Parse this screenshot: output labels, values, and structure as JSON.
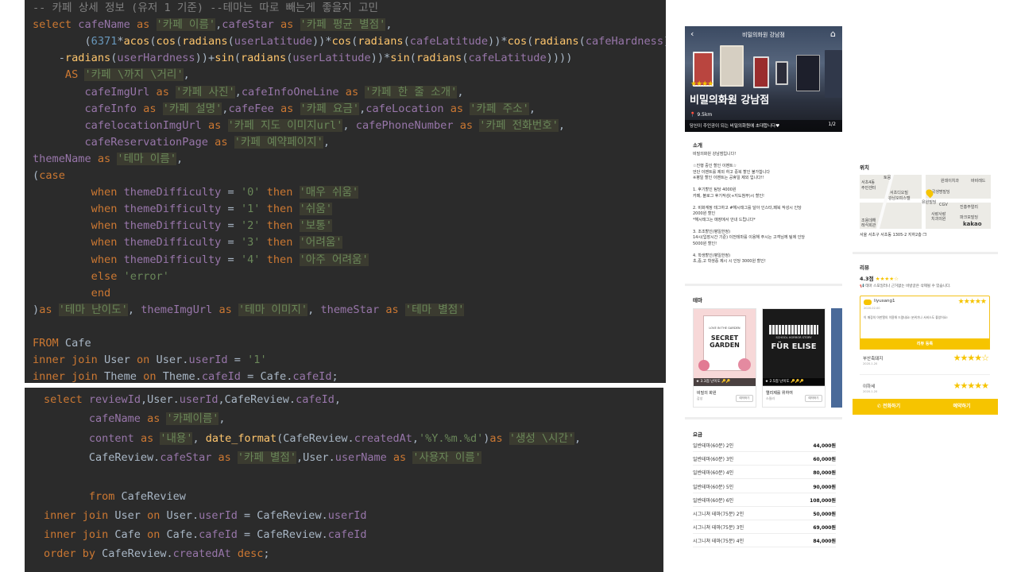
{
  "top_code": {
    "lines": [
      "-- 카페 상세 정보 (유저 1 기준) --테마는 따로 빼는게 좋을지 고민",
      "select cafeName as '카페 이름',cafeStar as '카페 평균 별점',",
      "        (6371*acos(cos(radians(userLatitude))*cos(radians(cafeLatitude))*cos(radians(cafeHardness)",
      "    -radians(userHardness))+sin(radians(userLatitude))*sin(radians(cafeLatitude))))",
      "     AS '카페 \\까지 \\거리',",
      "        cafeImgUrl as '카페 사진',cafeInfoOneLine as '카페 한 줄 소개',",
      "        cafeInfo as '카페 설명',cafeFee as '카페 요금',cafeLocation as '카페 주소',",
      "        cafelocationImgUrl as '카페 지도 이미지url', cafePhoneNumber as '카페 전화번호',",
      "        cafeReservationPage as '카페 예약페이지',",
      "themeName as '테마 이름',",
      "(case",
      "         when themeDifficulty = '0' then '매우 쉬움'",
      "         when themeDifficulty = '1' then '쉬움'",
      "         when themeDifficulty = '2' then '보통'",
      "         when themeDifficulty = '3' then '어려움'",
      "         when themeDifficulty = '4' then '아주 어려움'",
      "         else 'error'",
      "         end",
      ")as '테마 난이도', themeImgUrl as '테마 이미지', themeStar as '테마 별점'",
      "",
      "FROM Cafe",
      "inner join User on User.userId = '1'",
      "inner join Theme on Theme.cafeId = Cafe.cafeId;"
    ]
  },
  "bottom_code": {
    "lines": [
      "select reviewId,User.userId,CafeReview.cafeId,",
      "       cafeName as '카페이름',",
      "       content as '내용', date_format(CafeReview.createdAt,'%Y.%m.%d')as '생성 \\시간',",
      "       CafeReview.cafeStar as '카페 별점',User.userName as '사용자 이름'",
      "",
      "       from CafeReview",
      "inner join User on User.userId = CafeReview.userId",
      "inner join Cafe on Cafe.cafeId = CafeReview.cafeId",
      "order by CafeReview.createdAt desc;"
    ]
  },
  "phone_left": {
    "top_title": "비밀의화원 강남점",
    "hero_stars": "★★★★",
    "hero_name": "비밀의화원 강남점",
    "distance": "9.5km",
    "hero_desc": "당신이 주인공이 되는 비밀의화원에 초대합니다♥",
    "page_indicator": "1/2",
    "intro_label": "소개",
    "intro_text": "비밀의화원 강남점입니다!\n\n☆진행 중인 할인 이벤트☆\n언단 이벤트를 제외 하고 중복 할인 불가합니다\n※평일 할인 이벤트는 공휴일 제외 입니다!!\n\n1. 후기할인 팀당 4000원\n카페, 블로그 후기작성(+지도첨부)시 할인!\n\n2. 비화계정 태그하고 #해시태그를 달아 인스타,페북 작성시 인당\n2000원 할인\n*해시태그는 매장에서 안내 드립니다*\n\n3. 조조할인(평일한정)\n14시(입장시간 기준) 이전테마를 이용해 주시는 고객님께 팀에 인당\n5000원 할인!\n\n4. 학생할인(평일한정)\n초,중,고 학생증 제시 시 인당 3000원 할인!",
    "theme_label": "테마",
    "themes": [
      {
        "title": "비밀의 화원",
        "sub": "감성",
        "meta": "★ 3.3점  난이도 🔑🔑",
        "btn": "예약하기",
        "poster_top": "LOVE IN THE GARDEN",
        "poster_main": "SECRET GARDEN"
      },
      {
        "title": "엘리제를 위하여",
        "sub": "스릴러",
        "meta": "★ 2.5점  난이도 🔑🔑🔑",
        "btn": "예약하기",
        "poster_top": "SCHOOL HORROR STORY",
        "poster_main": "FÜR ELISE"
      }
    ],
    "fee_label": "요금",
    "fees": [
      {
        "name": "일반테마(60분) 2인",
        "price": "44,000원"
      },
      {
        "name": "일반테마(60분) 3인",
        "price": "60,000원"
      },
      {
        "name": "일반테마(60분) 4인",
        "price": "80,000원"
      },
      {
        "name": "일반테마(60분) 5인",
        "price": "90,000원"
      },
      {
        "name": "일반테마(60분) 6인",
        "price": "108,000원"
      },
      {
        "name": "시그니쳐 테마(75분) 2인",
        "price": "50,000원"
      },
      {
        "name": "시그니쳐 테마(75분) 3인",
        "price": "69,000원"
      },
      {
        "name": "시그니쳐 테마(75분) 4인",
        "price": "84,000원"
      }
    ]
  },
  "phone_right": {
    "location_label": "위치",
    "map_labels": [
      "토뭉",
      "서초4동",
      "주민센터",
      "서초디오빌",
      "강남오피스텔",
      "원데이치과",
      "바비레드",
      "흥국생명빌딩",
      "유원빌딩",
      "CGV",
      "진흥주얼리",
      "사랑사랑",
      "치과의원",
      "파크모빌딩",
      "조용데해",
      "레식회관",
      "kakao"
    ],
    "address": "서울 서초구 서초동 1305-2 지하2층",
    "review_label": "리뷰",
    "rating_text": "4.3점",
    "rating_stars": "★★★★☆",
    "notice": "테마 스포일러나 근거없는 비방글은 삭제될 수 있습니다.",
    "top_review": {
      "user": "liyusang1",
      "date": "2020.02.00",
      "stars": "★★★★★",
      "text": "이 매장의 아판엘의 이용해 드렸네요! 분위기나 서비스도 좋았어요!"
    },
    "review_button": "리뷰 등록",
    "reviews": [
      {
        "user": "부산축돼지",
        "date": "2020.1.20",
        "stars": "★★★★☆"
      },
      {
        "user": "이하세",
        "date": "2020.1.20",
        "stars": "★★★★★"
      }
    ],
    "call_label": "전화하기",
    "reserve_label": "예약하기"
  },
  "colors": {
    "accent": "#f6c400",
    "code_bg": "#2b2b2b",
    "keyword": "#cc7832",
    "string": "#6a8759",
    "field": "#9876aa",
    "func": "#ffc66d",
    "number": "#6897bb",
    "comment": "#808080"
  }
}
